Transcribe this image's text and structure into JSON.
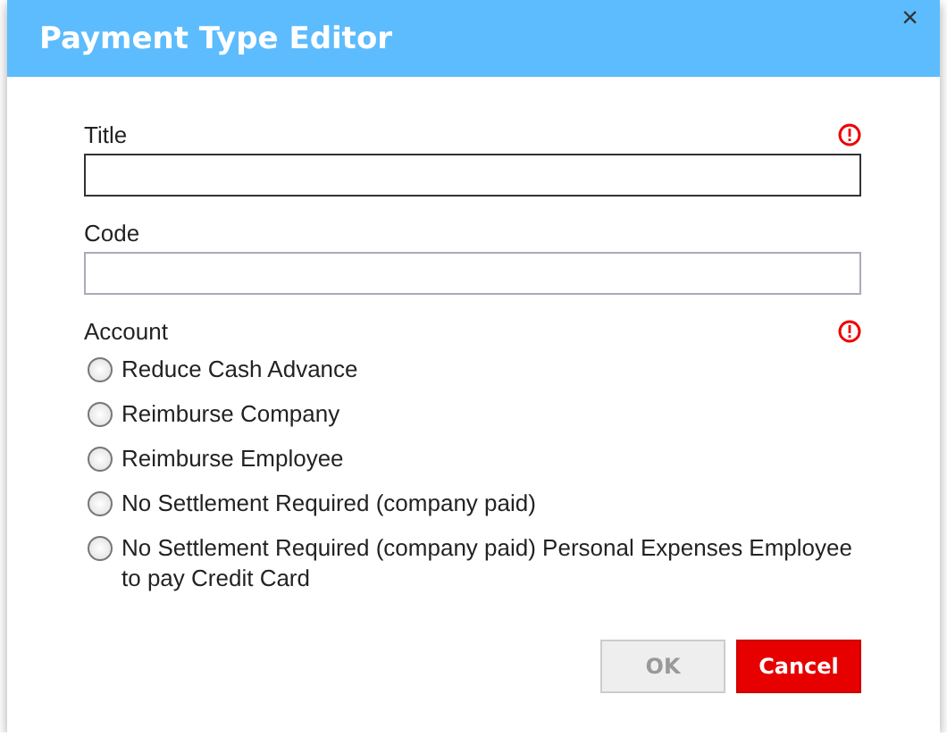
{
  "dialog": {
    "title": "Payment Type Editor",
    "close": "×"
  },
  "fields": [
    {
      "label": "Title",
      "required": true,
      "focused": true
    },
    {
      "label": "Code",
      "required": false,
      "focused": false
    }
  ],
  "account": {
    "label": "Account",
    "required": true,
    "options": [
      {
        "label": "Reduce Cash Advance",
        "selected": false
      },
      {
        "label": "Reimburse Company",
        "selected": false
      },
      {
        "label": "Reimburse Employee",
        "selected": false
      },
      {
        "label": "No Settlement Required (company paid)",
        "selected": false
      },
      {
        "label": "No Settlement Required (company paid) Personal Expenses Employee to pay Credit Card",
        "selected": false
      }
    ]
  },
  "buttons": [
    {
      "label": "OK",
      "kind": "default",
      "disabled": true
    },
    {
      "label": "Cancel",
      "kind": "danger",
      "disabled": false
    }
  ]
}
